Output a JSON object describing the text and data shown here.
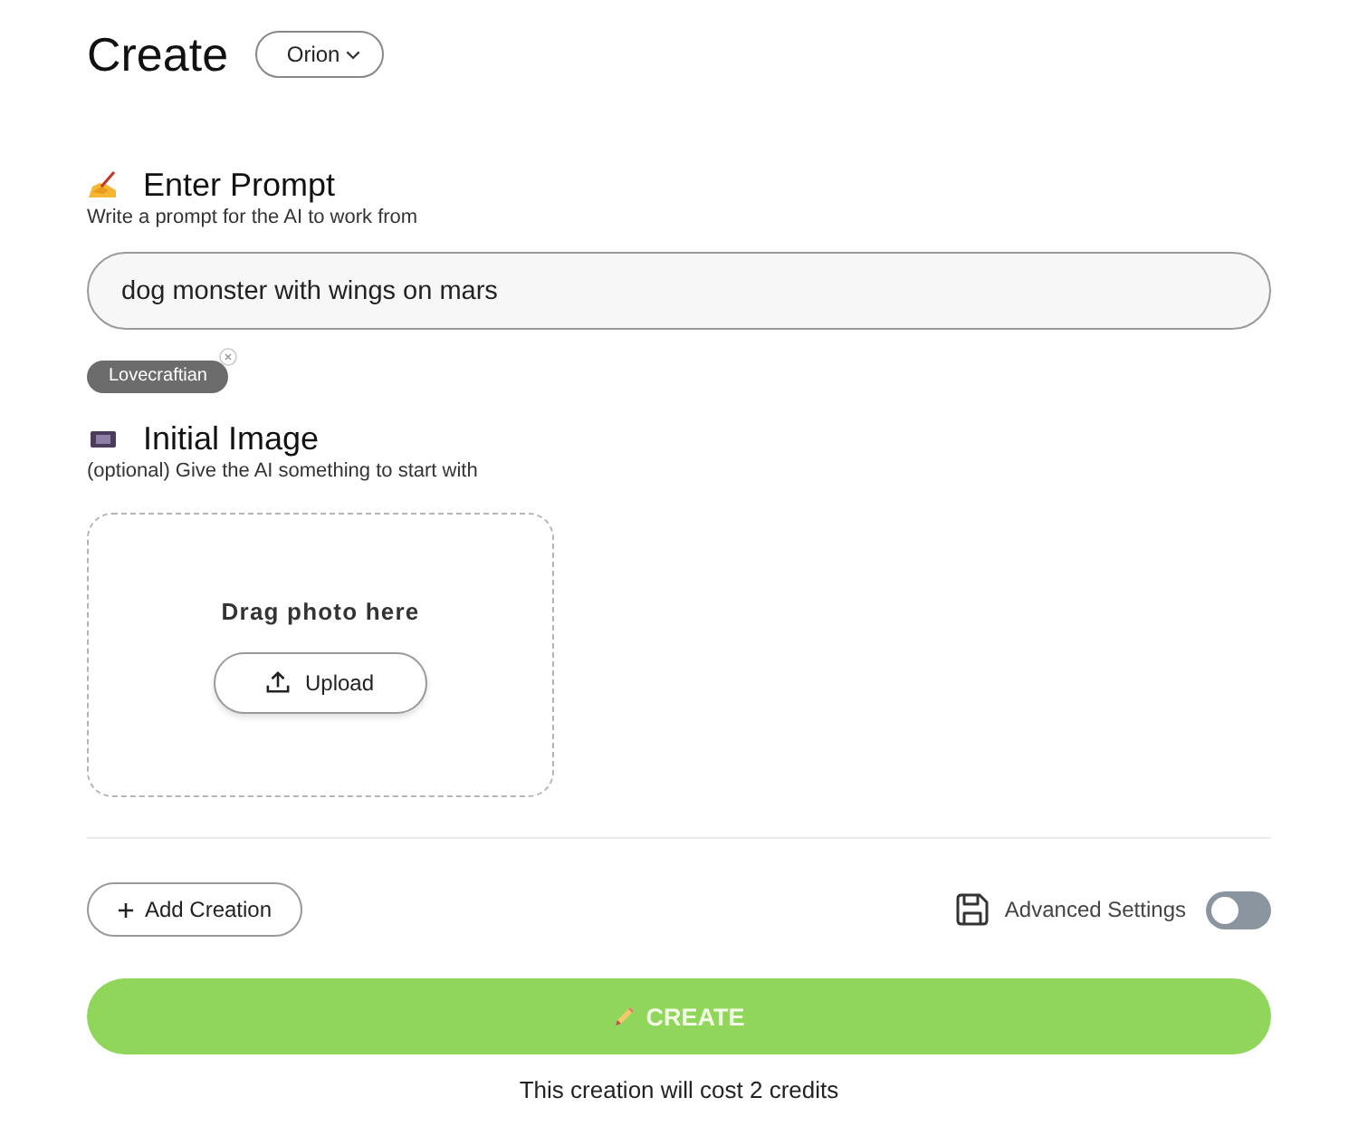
{
  "header": {
    "title": "Create",
    "model_dropdown": {
      "label": "Orion"
    }
  },
  "prompt_section": {
    "title": "Enter Prompt",
    "subtitle": "Write a prompt for the AI to work from",
    "input": {
      "value": "dog monster with wings on mars"
    },
    "tags": [
      {
        "label": "Lovecraftian"
      }
    ]
  },
  "image_section": {
    "title": "Initial Image",
    "subtitle": "(optional) Give the AI something to start with",
    "dropzone": {
      "text": "Drag photo here",
      "button": "Upload"
    }
  },
  "actions": {
    "add_button": "Add Creation",
    "advanced_settings": {
      "label": "Advanced Settings",
      "on": false
    }
  },
  "create_button": {
    "label": "CREATE"
  },
  "cost_note": "This creation will cost 2 credits"
}
